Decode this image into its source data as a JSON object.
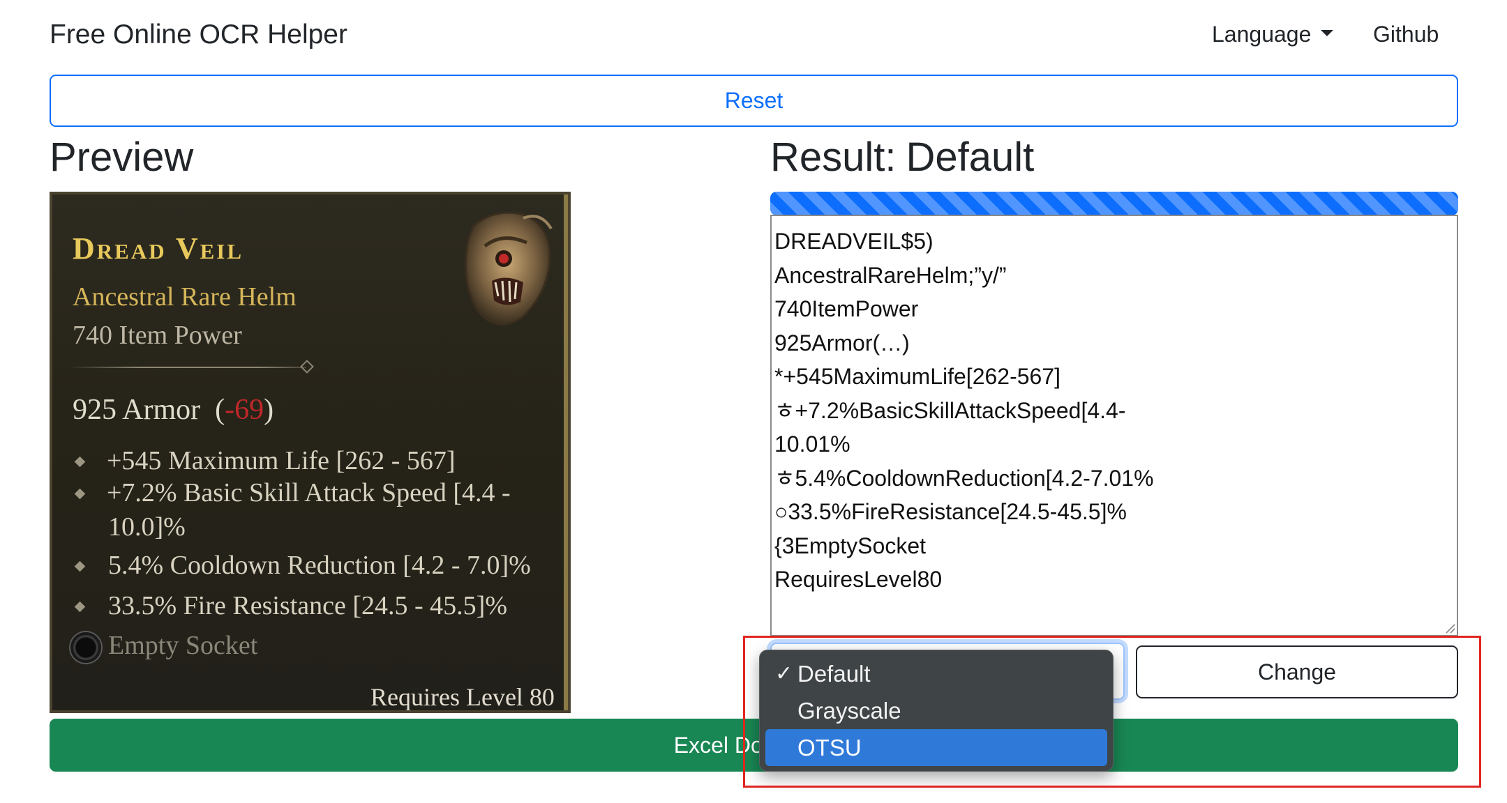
{
  "navbar": {
    "brand": "Free Online OCR Helper",
    "language": "Language",
    "github": "Github"
  },
  "reset_label": "Reset",
  "preview": {
    "heading": "Preview",
    "card": {
      "title": "Dread Veil",
      "item_type": "Ancestral Rare Helm",
      "power": "740 Item Power",
      "armor_value": "925 Armor",
      "armor_delta": "-69",
      "stats": [
        "+545 Maximum Life [262 - 567]",
        "+7.2% Basic Skill Attack Speed  [4.4 -",
        "10.0]%",
        "5.4% Cooldown Reduction [4.2 - 7.0]%",
        "33.5% Fire Resistance [24.5 - 45.5]%"
      ],
      "empty_socket": "Empty Socket",
      "requires": "Requires Level 80"
    }
  },
  "result": {
    "label": "Result:",
    "mode": "Default",
    "lines": [
      "DREADVEIL$5)",
      "AncestralRareHelm;”y/”",
      "740ItemPower",
      "925Armor(…)",
      "*+545MaximumLife[262-567]",
      "ㅎ+7.2%BasicSkillAttackSpeed[4.4-",
      "10.01%",
      "ㅎ5.4%CooldownReduction[4.2-7.01%",
      "○33.5%FireResistance[24.5-45.5]%",
      "{3EmptySocket",
      "RequiresLevel80"
    ]
  },
  "controls": {
    "change_label": "Change",
    "excel_label": "Excel Download",
    "dropdown": {
      "options": [
        "Default",
        "Grayscale",
        "OTSU"
      ],
      "selected": "Default",
      "highlighted": "OTSU"
    }
  },
  "colors": {
    "primary": "#0d6efd",
    "success": "#198754",
    "annotation": "#e0261f",
    "dropdown_bg": "#3f4446",
    "dropdown_highlight": "#2f7ad9"
  }
}
